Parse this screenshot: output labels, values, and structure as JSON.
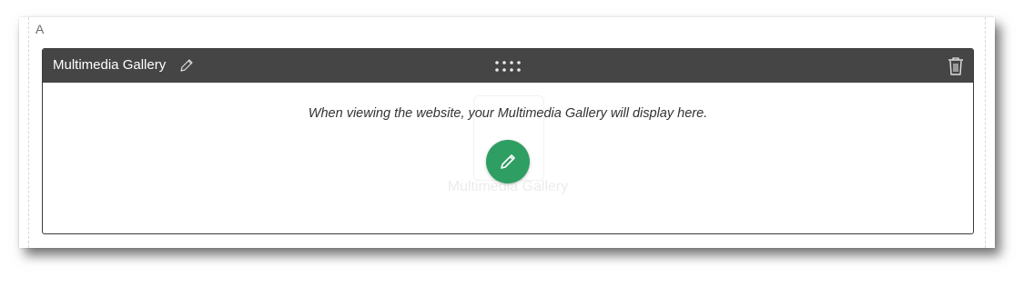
{
  "zone": {
    "label": "A"
  },
  "widget": {
    "title": "Multimedia Gallery",
    "message": "When viewing the website, your Multimedia Gallery will display here.",
    "placeholder_label": "Multimedia Gallery",
    "icons": {
      "title_edit": "pencil-icon",
      "drag": "drag-handle-icon",
      "delete": "trash-icon",
      "edit": "pencil-icon"
    }
  },
  "colors": {
    "header_bg": "#454545",
    "edit_button": "#2f9e63"
  }
}
